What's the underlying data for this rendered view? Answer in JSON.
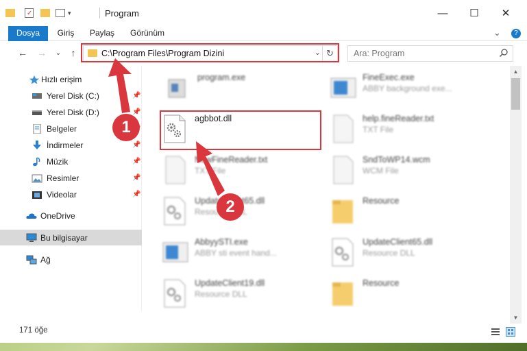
{
  "window": {
    "title": "Program",
    "controls": {
      "minimize": "—",
      "maximize": "☐",
      "close": "✕"
    }
  },
  "ribbon": {
    "tabs": [
      "Dosya",
      "Giriş",
      "Paylaş",
      "Görünüm"
    ],
    "expand": "⌄",
    "help": "?"
  },
  "nav": {
    "back": "←",
    "forward": "→",
    "recent": "⌄",
    "up": "↑"
  },
  "address": {
    "path": "C:\\Program Files\\Program Dizini",
    "dropdown": "⌄",
    "refresh": "↻"
  },
  "search": {
    "placeholder": "Ara: Program"
  },
  "sidebar": {
    "items": [
      {
        "label": "Hızlı erişim",
        "icon": "star-icon"
      },
      {
        "label": "Yerel Disk (C:)",
        "icon": "disk-icon",
        "pinned": true
      },
      {
        "label": "Yerel Disk (D:)",
        "icon": "disk-icon",
        "pinned": true
      },
      {
        "label": "Belgeler",
        "icon": "documents-icon",
        "pinned": true
      },
      {
        "label": "İndirmeler",
        "icon": "download-icon",
        "pinned": true
      },
      {
        "label": "Müzik",
        "icon": "music-icon",
        "pinned": true
      },
      {
        "label": "Resimler",
        "icon": "pictures-icon",
        "pinned": true
      },
      {
        "label": "Videolar",
        "icon": "videos-icon",
        "pinned": true
      },
      {
        "label": "OneDrive",
        "icon": "onedrive-icon"
      },
      {
        "label": "Bu bilgisayar",
        "icon": "computer-icon",
        "selected": true
      },
      {
        "label": "Ağ",
        "icon": "network-icon"
      }
    ],
    "pin_glyph": "📌"
  },
  "files": [
    {
      "name": "program.exe",
      "desc": "",
      "icon": "exe-icon"
    },
    {
      "name": "FineExec.exe",
      "desc": "ABBY background exe...",
      "icon": "exe-blue-icon"
    },
    {
      "name": "agbbot.dll",
      "desc": "",
      "icon": "dll-icon",
      "highlighted": true
    },
    {
      "name": "help.fineReader.txt",
      "desc": "TXT File",
      "icon": "txt-icon"
    },
    {
      "name": "NewFineReader.txt",
      "desc": "TXT File",
      "icon": "txt-icon"
    },
    {
      "name": "SndToWP14.wcm",
      "desc": "WCM File",
      "icon": "txt-icon"
    },
    {
      "name": "UpdateClient65.dll",
      "desc": "Resource DLL",
      "icon": "dll-icon"
    },
    {
      "name": "Resource",
      "desc": "",
      "icon": "folder-icon"
    },
    {
      "name": "AbbyySTI.exe",
      "desc": "ABBY sti event hand...",
      "icon": "exe-blue-icon"
    },
    {
      "name": "UpdateClient65.dll",
      "desc": "Resource DLL",
      "icon": "dll-icon"
    },
    {
      "name": "UpdateClient19.dll",
      "desc": "Resource DLL",
      "icon": "dll-icon"
    },
    {
      "name": "Resource",
      "desc": "",
      "icon": "folder-icon"
    }
  ],
  "status": {
    "count": "171 öğe"
  },
  "annotations": {
    "step1": "1",
    "step2": "2",
    "color": "#d9363e"
  },
  "colors": {
    "file_tab": "#1979ca",
    "selected_sidebar": "#d9d9d9",
    "highlight": "#d9363e",
    "folder": "#f4c553"
  }
}
